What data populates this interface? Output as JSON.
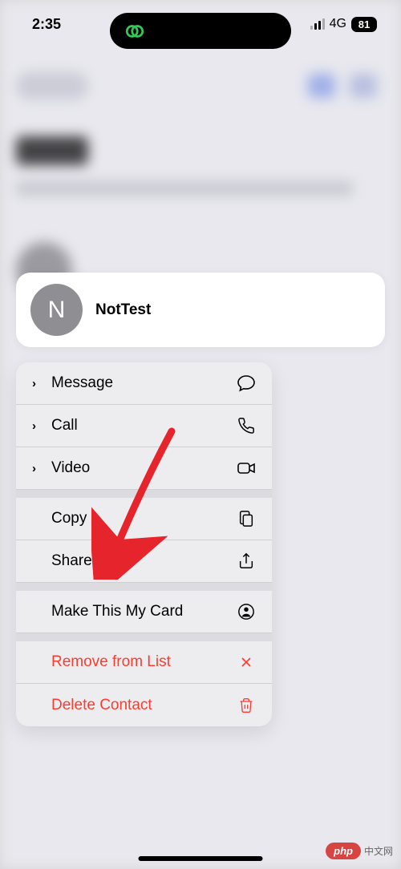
{
  "status": {
    "time": "2:35",
    "network_type": "4G",
    "battery_percent": "81"
  },
  "contact": {
    "initial": "N",
    "name": "NotTest"
  },
  "menu": {
    "message": "Message",
    "call": "Call",
    "video": "Video",
    "copy": "Copy",
    "share": "Share",
    "make_card": "Make This My Card",
    "remove": "Remove from List",
    "delete": "Delete Contact"
  },
  "watermark": {
    "badge": "php",
    "text": "中文网"
  }
}
